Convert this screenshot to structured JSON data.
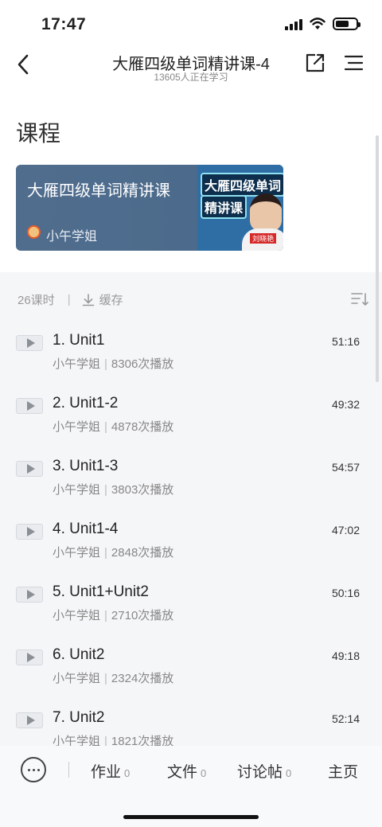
{
  "status_bar": {
    "time": "17:47"
  },
  "nav": {
    "title": "大雁四级单词精讲课-4",
    "subtitle": "13605人正在学习"
  },
  "course": {
    "section_title": "课程",
    "card_title": "大雁四级单词精讲课",
    "teacher": "小午学姐",
    "cover_line1": "大雁四级单词",
    "cover_line2": "精讲课",
    "cover_name": "刘晓艳"
  },
  "list": {
    "lesson_count": "26课时",
    "cache_label": "缓存",
    "lessons": [
      {
        "title": "1. Unit1",
        "author": "小午学姐",
        "plays": "8306次播放",
        "duration": "51:16"
      },
      {
        "title": "2. Unit1-2",
        "author": "小午学姐",
        "plays": "4878次播放",
        "duration": "49:32"
      },
      {
        "title": "3. Unit1-3",
        "author": "小午学姐",
        "plays": "3803次播放",
        "duration": "54:57"
      },
      {
        "title": "4. Unit1-4",
        "author": "小午学姐",
        "plays": "2848次播放",
        "duration": "47:02"
      },
      {
        "title": "5. Unit1+Unit2",
        "author": "小午学姐",
        "plays": "2710次播放",
        "duration": "50:16"
      },
      {
        "title": "6. Unit2",
        "author": "小午学姐",
        "plays": "2324次播放",
        "duration": "49:18"
      },
      {
        "title": "7. Unit2",
        "author": "小午学姐",
        "plays": "1821次播放",
        "duration": "52:14"
      }
    ]
  },
  "bottom_bar": {
    "tabs": [
      {
        "label": "作业",
        "count": "0"
      },
      {
        "label": "文件",
        "count": "0"
      },
      {
        "label": "讨论帖",
        "count": "0"
      },
      {
        "label": "主页",
        "count": ""
      }
    ]
  },
  "colors": {
    "card_bg": "#4f6c8c",
    "page_bg": "#f5f6f8",
    "text_primary": "#222222",
    "text_secondary": "#888888"
  }
}
